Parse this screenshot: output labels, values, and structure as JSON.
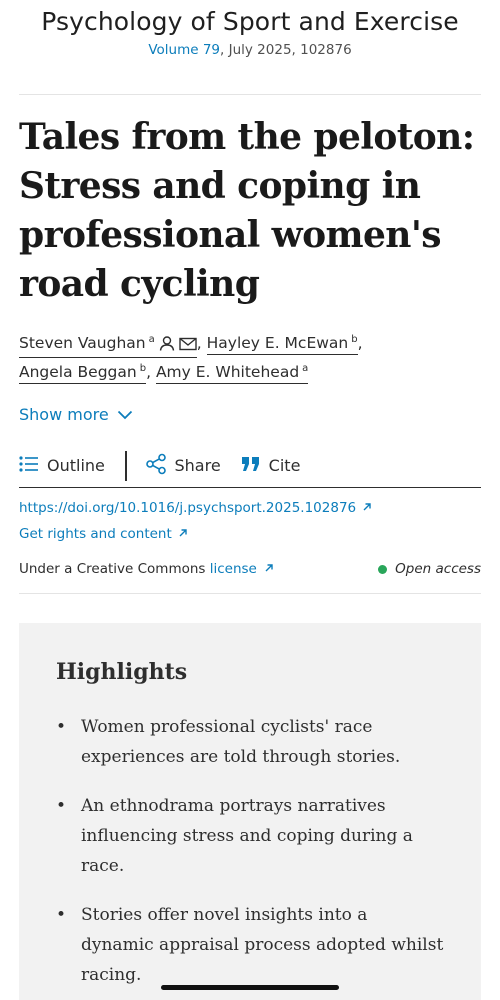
{
  "journal": {
    "title": "Psychology of Sport and Exercise",
    "volume_link": "Volume 79",
    "issue_info": ", July 2025, 102876"
  },
  "article": {
    "title": "Tales from the peloton: Stress and coping in professional women's road cycling"
  },
  "authors": [
    {
      "name": "Steven Vaughan",
      "affil": "a",
      "sep": ","
    },
    {
      "name": "Hayley E. McEwan",
      "affil": "b",
      "sep": ","
    },
    {
      "name": "Angela Beggan",
      "affil": "b",
      "sep": ","
    },
    {
      "name": "Amy E. Whitehead",
      "affil": "a",
      "sep": ""
    }
  ],
  "show_more": "Show more",
  "toolbar": {
    "outline": "Outline",
    "share": "Share",
    "cite": "Cite"
  },
  "links": {
    "doi": "https://doi.org/10.1016/j.psychsport.2025.102876",
    "rights": "Get rights and content"
  },
  "license": {
    "prefix": "Under a Creative Commons ",
    "link": "license",
    "access": "Open access"
  },
  "highlights": {
    "title": "Highlights",
    "items": [
      "Women professional cyclists' race experiences are told through stories.",
      "An ethnodrama portrays narratives influencing stress and coping during a race.",
      "Stories offer novel insights into a dynamic appraisal process adopted whilst racing."
    ]
  },
  "colors": {
    "link": "#0c7dbb",
    "open_access": "#29a65a",
    "highlights_bg": "#f2f2f2"
  }
}
